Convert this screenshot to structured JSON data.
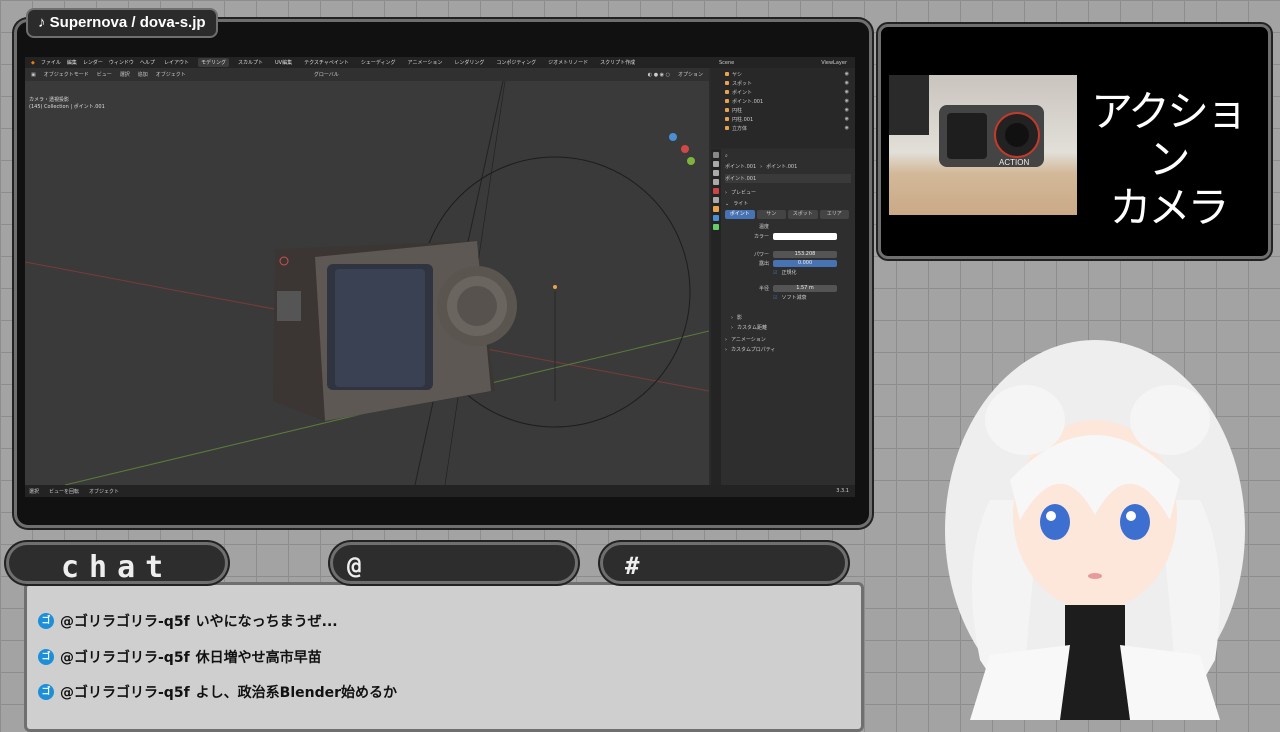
{
  "music": "♪ Supernova / dova-s.jp",
  "blender": {
    "menus": [
      "ファイル",
      "編集",
      "レンダー",
      "ウィンドウ",
      "ヘルプ"
    ],
    "workspaces": [
      "レイアウト",
      "モデリング",
      "スカルプト",
      "UV編集",
      "テクスチャペイント",
      "シェーディング",
      "アニメーション",
      "レンダリング",
      "コンポジティング",
      "ジオメトリノード",
      "スクリプト作成"
    ],
    "active_workspace": "モデリング",
    "header_mode": "オブジェクトモード",
    "header_items": [
      "ビュー",
      "選択",
      "追加",
      "オブジェクト"
    ],
    "transform": "グローバル",
    "options": "オプション",
    "view_info_line1": "カメラ・透視投影",
    "view_info_line2": "(145) Collection | ポイント.001",
    "status": [
      "選択",
      "ビューを回転",
      "オブジェクト"
    ],
    "version": "3.3.1",
    "outliner": {
      "scene": "Scene",
      "viewlayer": "ViewLayer",
      "items": [
        "ヤシ",
        "スポット",
        "ポイント",
        "ポイント.001",
        "円柱",
        "円柱.001",
        "立方体"
      ]
    },
    "props": {
      "breadcrumb_obj": "ポイント.001",
      "breadcrumb_data": "ポイント.001",
      "datablock": "ポイント.001",
      "preview": "プレビュー",
      "light": "ライト",
      "light_tabs": [
        "ポイント",
        "サン",
        "スポット",
        "エリア"
      ],
      "temperature": "温度",
      "color": "カラー",
      "power_label": "パワー",
      "power": "153.208",
      "exposure_label": "露出",
      "exposure": "0.000",
      "normalize": "正規化",
      "radius_label": "半径",
      "radius": "1.57 m",
      "soft_falloff": "ソフト減衰",
      "shadow": "影",
      "custom_distance": "カスタム距離",
      "animation": "アニメーション",
      "custom_props": "カスタムプロパティ"
    }
  },
  "preview": {
    "title_line1": "アクション",
    "title_line2": "カメラ",
    "cam_label": "ACTION"
  },
  "chat": {
    "chat_tab": "chat",
    "at_tab": "@",
    "hash_tab": "#",
    "messages": [
      {
        "user": "@ゴリラゴリラ-q5f",
        "text": "いやになっちまうぜ..."
      },
      {
        "user": "@ゴリラゴリラ-q5f",
        "text": "休日増やせ高市早苗"
      },
      {
        "user": "@ゴリラゴリラ-q5f",
        "text": "よし、政治系Blender始めるか"
      }
    ]
  },
  "colors": {
    "accent": "#4772b3",
    "chat_icon": "#1c8fd8",
    "light_color": "#ffffff"
  }
}
